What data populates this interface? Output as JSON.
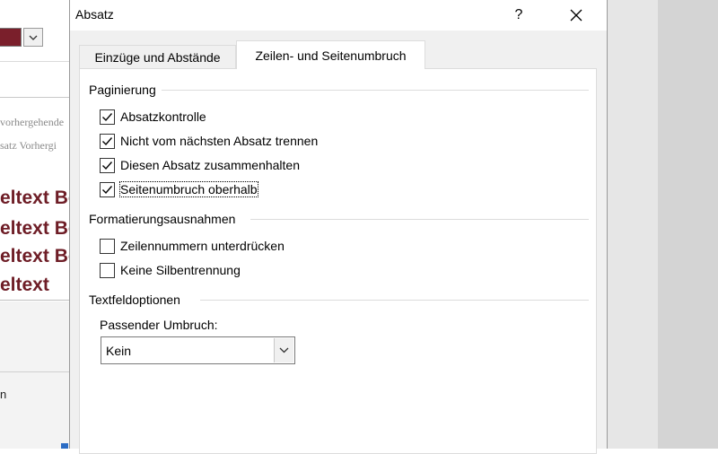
{
  "background_doc": {
    "gray_lines": [
      "vorhergehende",
      "satz Vorhergi"
    ],
    "red_lines": [
      "eltext Bo",
      "eltext Bo",
      "eltext Bo",
      "eltext"
    ],
    "lower_text": "n",
    "swatch_color": "#7a1f2b",
    "text_color": "#6e1d26"
  },
  "dialog": {
    "title": "Absatz",
    "help_label": "?",
    "close_icon": "close-icon",
    "tabs": [
      {
        "label": "Einzüge und Abstände",
        "selected": false
      },
      {
        "label": "Zeilen- und Seitenumbruch",
        "selected": true
      }
    ],
    "groups": {
      "paginierung": {
        "label": "Paginierung",
        "items": [
          {
            "label": "Absatzkontrolle",
            "checked": true
          },
          {
            "label": "Nicht vom nächsten Absatz trennen",
            "checked": true
          },
          {
            "label": "Diesen Absatz zusammenhalten",
            "checked": true
          },
          {
            "label": "Seitenumbruch oberhalb",
            "checked": true
          }
        ]
      },
      "formatierung": {
        "label": "Formatierungsausnahmen",
        "items": [
          {
            "label": "Zeilennummern unterdrücken",
            "checked": false
          },
          {
            "label": "Keine Silbentrennung",
            "checked": false
          }
        ]
      },
      "textfeld": {
        "label": "Textfeldoptionen",
        "field_label": "Passender Umbruch:",
        "select_value": "Kein"
      }
    }
  }
}
